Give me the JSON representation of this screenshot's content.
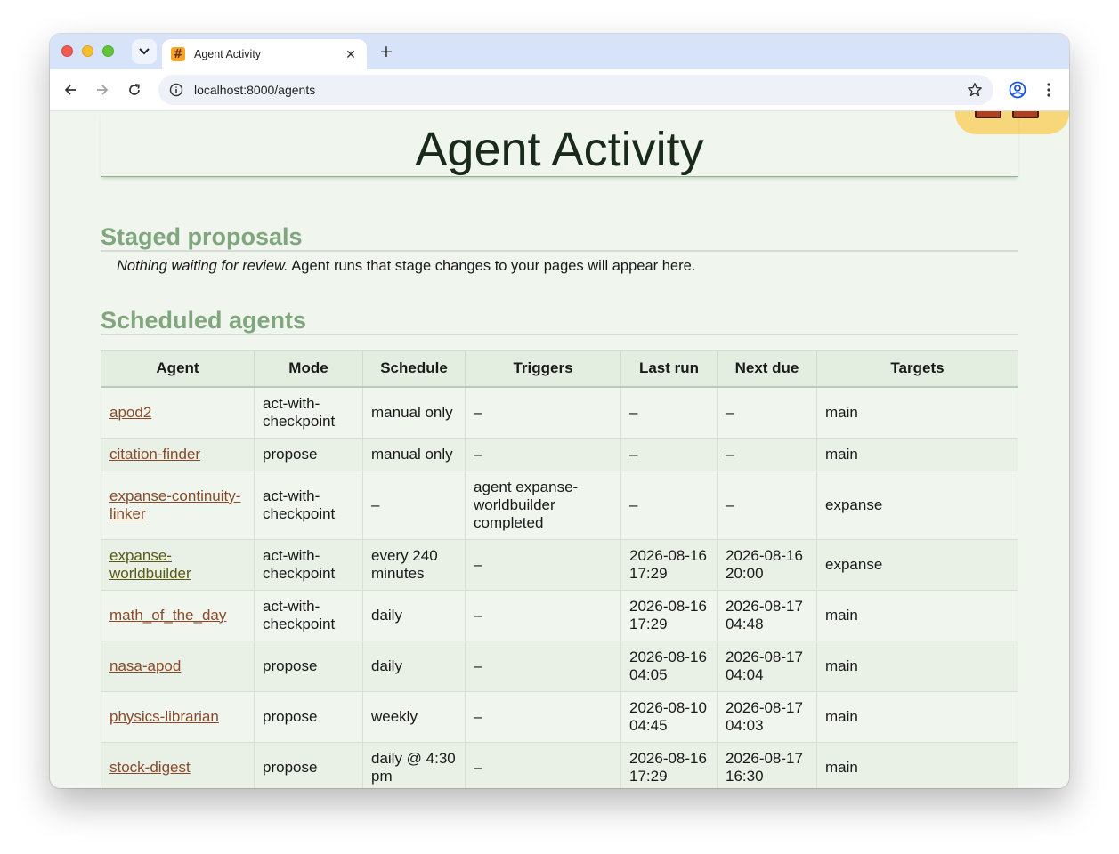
{
  "browser": {
    "tab_title": "Agent Activity",
    "tab_favicon": "#",
    "url": "localhost:8000/agents",
    "new_tab_label": "+"
  },
  "page": {
    "title": "Agent Activity",
    "staged_heading": "Staged proposals",
    "staged_empty_emphasis": "Nothing waiting for review.",
    "staged_empty_text": " Agent runs that stage changes to your pages will appear here.",
    "scheduled_heading": "Scheduled agents"
  },
  "table": {
    "headers": [
      "Agent",
      "Mode",
      "Schedule",
      "Triggers",
      "Last run",
      "Next due",
      "Targets"
    ],
    "rows": [
      {
        "agent": "apod2",
        "mode": "act-with-checkpoint",
        "schedule": "manual only",
        "schedule_italic": true,
        "triggers": "–",
        "last_run": "–",
        "next_due": "–",
        "targets": "main"
      },
      {
        "agent": "citation-finder",
        "mode": "propose",
        "schedule": "manual only",
        "schedule_italic": true,
        "triggers": "–",
        "last_run": "–",
        "next_due": "–",
        "targets": "main"
      },
      {
        "agent": "expanse-continuity-linker",
        "mode": "act-with-checkpoint",
        "schedule": "–",
        "schedule_italic": false,
        "triggers": "agent expanse-worldbuilder completed",
        "last_run": "–",
        "next_due": "–",
        "targets": "expanse"
      },
      {
        "agent": "expanse-worldbuilder",
        "mode": "act-with-checkpoint",
        "schedule": "every 240 minutes",
        "schedule_italic": false,
        "triggers": "–",
        "last_run": "2026-08-16 17:29",
        "next_due": "2026-08-16 20:00",
        "targets": "expanse"
      },
      {
        "agent": "math_of_the_day",
        "mode": "act-with-checkpoint",
        "schedule": "daily",
        "schedule_italic": false,
        "triggers": "–",
        "last_run": "2026-08-16 17:29",
        "next_due": "2026-08-17 04:48",
        "targets": "main"
      },
      {
        "agent": "nasa-apod",
        "mode": "propose",
        "schedule": "daily",
        "schedule_italic": false,
        "triggers": "–",
        "last_run": "2026-08-16 04:05",
        "next_due": "2026-08-17 04:04",
        "targets": "main"
      },
      {
        "agent": "physics-librarian",
        "mode": "propose",
        "schedule": "weekly",
        "schedule_italic": false,
        "triggers": "–",
        "last_run": "2026-08-10 04:45",
        "next_due": "2026-08-17 04:03",
        "targets": "main"
      },
      {
        "agent": "stock-digest",
        "mode": "propose",
        "schedule": "daily @ 4:30 pm",
        "schedule_italic": false,
        "triggers": "–",
        "last_run": "2026-08-16 17:29",
        "next_due": "2026-08-17 16:30",
        "targets": "main"
      }
    ]
  },
  "colors": {
    "heading_green": "#7fa67d",
    "link": "#8a4a2a",
    "page_bg": "#f0f5ee",
    "tabbar_bg": "#d6e3f9"
  },
  "icons": [
    "back-arrow-icon",
    "forward-arrow-icon",
    "reload-icon",
    "site-info-icon",
    "bookmark-star-icon",
    "profile-icon",
    "kebab-menu-icon",
    "tab-dropdown-icon",
    "close-icon"
  ]
}
